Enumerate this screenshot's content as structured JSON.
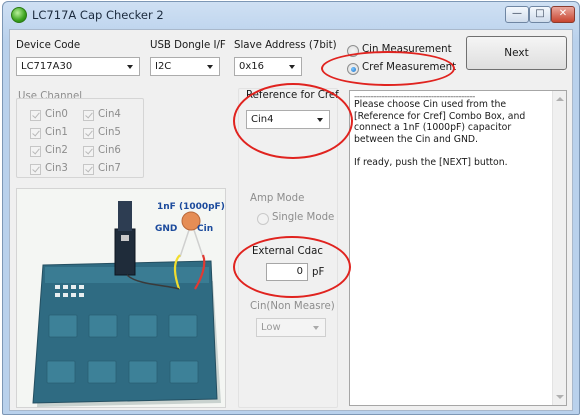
{
  "window": {
    "title": "LC717A Cap Checker 2",
    "minimize": "—",
    "maximize": "□",
    "close": "✕"
  },
  "device": {
    "label": "Device Code",
    "value": "LC717A30"
  },
  "usb": {
    "label": "USB Dongle I/F",
    "value": "I2C"
  },
  "slave": {
    "label": "Slave Address (7bit)",
    "value": "0x16"
  },
  "measure": {
    "cin_label": "Cin Measurement",
    "cref_label": "Cref Measurement",
    "selected": "cref"
  },
  "next_button": "Next",
  "use_channel": {
    "label": "Use Channel",
    "channels": [
      "Cin0",
      "Cin4",
      "Cin1",
      "Cin5",
      "Cin2",
      "Cin6",
      "Cin3",
      "Cin7"
    ]
  },
  "reference": {
    "label": "Reference for Cref",
    "value": "Cin4"
  },
  "amp_mode": {
    "label": "Amp Mode",
    "option": "Single Mode"
  },
  "cdac": {
    "label": "External Cdac",
    "value": "0",
    "unit": "pF"
  },
  "cin_non": {
    "label": "Cin(Non Measre)",
    "value": "Low"
  },
  "photo": {
    "cap_label": "1nF (1000pF)",
    "gnd_label": "GND",
    "cin_label": "Cin"
  },
  "instructions": {
    "dashes": "--------------------------------------------",
    "paragraph1": "Please choose Cin used from the [Reference for Cref] Combo Box, and connect a 1nF (1000pF) capacitor between the Cin and GND.",
    "paragraph2": "If ready, push the [NEXT] button."
  },
  "colors": {
    "annotation": "#e0231f",
    "board": "#2e6b80",
    "accent": "#1d6fc6"
  }
}
